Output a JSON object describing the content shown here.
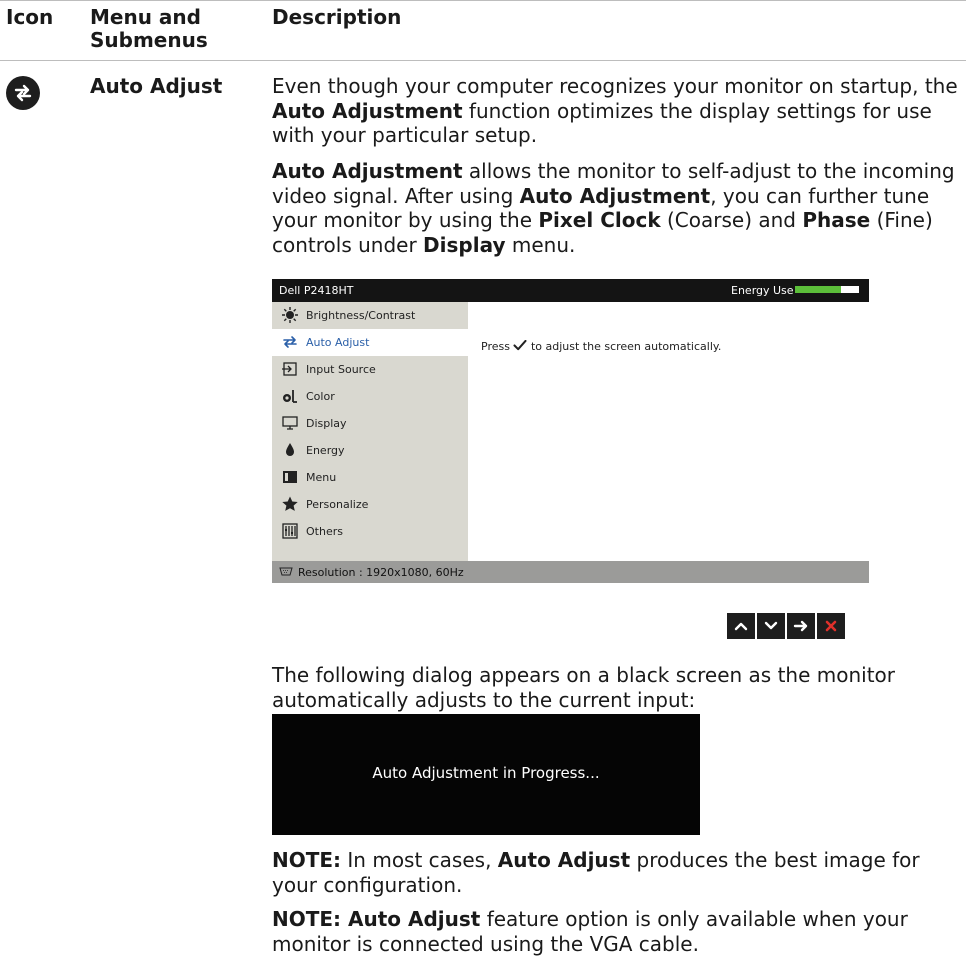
{
  "table_header": {
    "col_icon": "Icon",
    "col_menu": "Menu and Submenus",
    "col_description": "Description"
  },
  "row": {
    "icon": "auto-adjust-icon",
    "name": "Auto Adjust",
    "para1": {
      "t1": "Even though your computer recognizes your monitor on startup, the ",
      "b1": "Auto Adjustment",
      "t2": " function optimizes the display settings for use with your particular setup."
    },
    "para2": {
      "b1": "Auto Adjustment",
      "t1": " allows the monitor to self-adjust to the incoming video signal. After using ",
      "b2": "Auto Adjustment",
      "t2": ", you can further tune your monitor by using the ",
      "b3": "Pixel Clock",
      "t3": " (Coarse) and ",
      "b4": "Phase",
      "t4": " (Fine) controls under ",
      "b5": "Display",
      "t5": " menu."
    },
    "para3": "The following dialog appears on a black screen as the monitor automatically adjusts to the current input:",
    "note1": {
      "label": "NOTE:",
      "t1": " In most cases, ",
      "b1": "Auto Adjust",
      "t2": " produces the best image for your configuration."
    },
    "note2": {
      "label": "NOTE: Auto Adjust",
      "t1": " feature option is only available when your monitor is connected using the VGA cable."
    }
  },
  "osd": {
    "model": "Dell P2418HT",
    "energy_label": "Energy Use",
    "energy_level": 0.72,
    "menu_items": [
      {
        "label": "Brightness/Contrast",
        "icon": "brightness-icon"
      },
      {
        "label": "Auto Adjust",
        "icon": "auto-adjust-icon"
      },
      {
        "label": "Input Source",
        "icon": "input-source-icon"
      },
      {
        "label": "Color",
        "icon": "color-icon"
      },
      {
        "label": "Display",
        "icon": "display-icon"
      },
      {
        "label": "Energy",
        "icon": "energy-icon"
      },
      {
        "label": "Menu",
        "icon": "menu-icon"
      },
      {
        "label": "Personalize",
        "icon": "star-icon"
      },
      {
        "label": "Others",
        "icon": "others-icon"
      }
    ],
    "selected_index": 1,
    "panel_message_pre": "Press",
    "panel_message_icon": "checkmark-icon",
    "panel_message_post": "to adjust the screen automatically.",
    "footer": "Resolution : 1920x1080, 60Hz",
    "footer_icon": "vga-connector-icon"
  },
  "nav_buttons": [
    "up-arrow-icon",
    "down-arrow-icon",
    "right-arrow-icon",
    "close-icon"
  ],
  "dialog_message": "Auto Adjustment in Progress...",
  "colors": {
    "energy_bar": "#5cbf3a",
    "close_red": "#e0302b",
    "selected_text": "#2a5fa8"
  }
}
